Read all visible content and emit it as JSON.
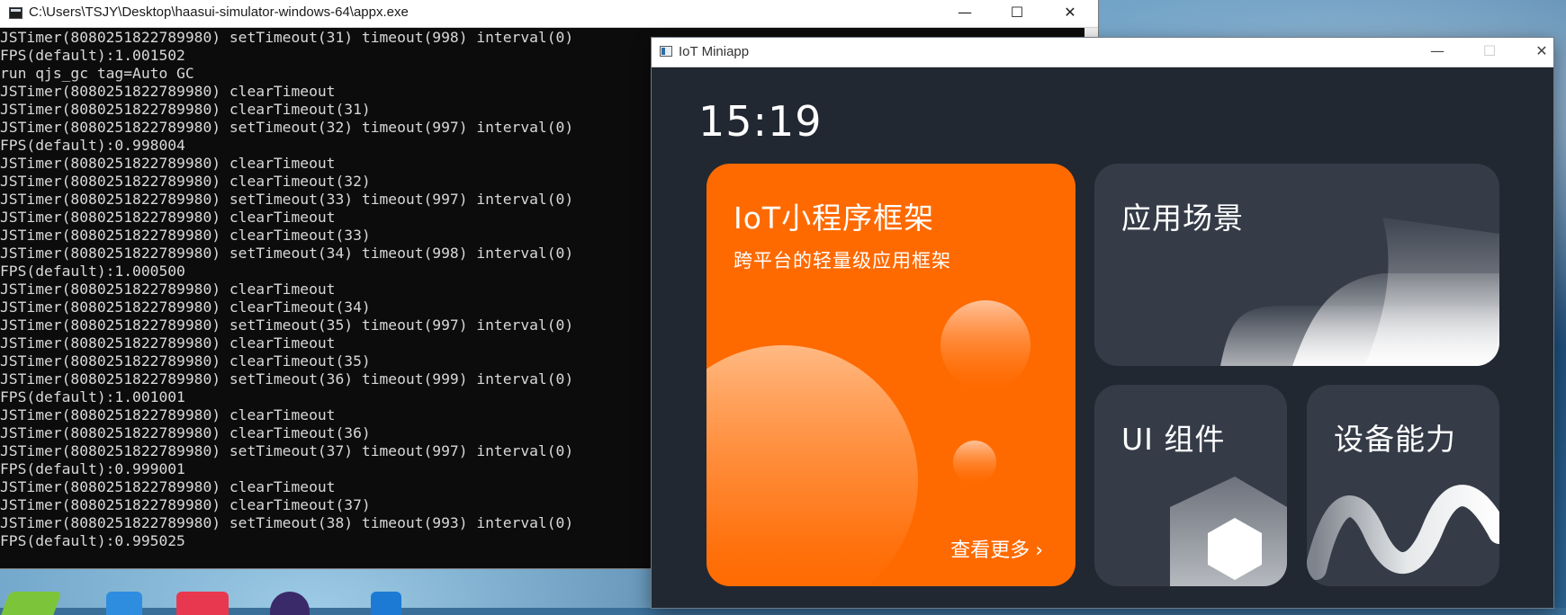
{
  "console": {
    "title": "C:\\Users\\TSJY\\Desktop\\haasui-simulator-windows-64\\appx.exe",
    "lines": [
      "JSTimer(8080251822789980) setTimeout(31) timeout(998) interval(0)",
      "FPS(default):1.001502",
      "run qjs_gc tag=Auto GC",
      "JSTimer(8080251822789980) clearTimeout",
      "JSTimer(8080251822789980) clearTimeout(31)",
      "JSTimer(8080251822789980) setTimeout(32) timeout(997) interval(0)",
      "FPS(default):0.998004",
      "JSTimer(8080251822789980) clearTimeout",
      "JSTimer(8080251822789980) clearTimeout(32)",
      "JSTimer(8080251822789980) setTimeout(33) timeout(997) interval(0)",
      "JSTimer(8080251822789980) clearTimeout",
      "JSTimer(8080251822789980) clearTimeout(33)",
      "JSTimer(8080251822789980) setTimeout(34) timeout(998) interval(0)",
      "FPS(default):1.000500",
      "JSTimer(8080251822789980) clearTimeout",
      "JSTimer(8080251822789980) clearTimeout(34)",
      "JSTimer(8080251822789980) setTimeout(35) timeout(997) interval(0)",
      "JSTimer(8080251822789980) clearTimeout",
      "JSTimer(8080251822789980) clearTimeout(35)",
      "JSTimer(8080251822789980) setTimeout(36) timeout(999) interval(0)",
      "FPS(default):1.001001",
      "JSTimer(8080251822789980) clearTimeout",
      "JSTimer(8080251822789980) clearTimeout(36)",
      "JSTimer(8080251822789980) setTimeout(37) timeout(997) interval(0)",
      "FPS(default):0.999001",
      "JSTimer(8080251822789980) clearTimeout",
      "JSTimer(8080251822789980) clearTimeout(37)",
      "JSTimer(8080251822789980) setTimeout(38) timeout(993) interval(0)",
      "FPS(default):0.995025"
    ],
    "controls": {
      "minimize": "—",
      "maximize": "☐",
      "close": "✕"
    }
  },
  "iot": {
    "title": "IoT Miniapp",
    "controls": {
      "minimize": "—",
      "maximize": "☐",
      "close": "✕"
    },
    "clock": "15:19",
    "cards": {
      "framework": {
        "title": "IoT小程序框架",
        "subtitle": "跨平台的轻量级应用框架",
        "more": "查看更多",
        "color": "#ff6a00"
      },
      "scenes": {
        "title": "应用场景"
      },
      "ui": {
        "title": "UI 组件"
      },
      "device": {
        "title": "设备能力"
      }
    },
    "icons": {
      "more": "chevron-right-icon",
      "app": "window-app-icon"
    }
  },
  "colors": {
    "console_bg": "#0c0c0c",
    "console_text": "#d8d8d8",
    "iot_bg": "#222831",
    "card_dark": "#353c48",
    "accent": "#ff6a00"
  }
}
